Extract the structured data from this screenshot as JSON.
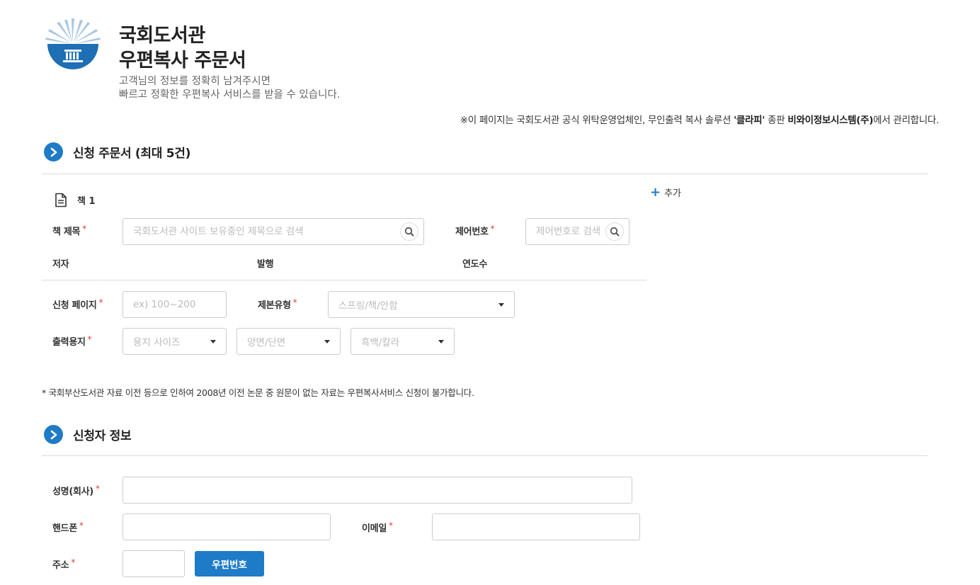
{
  "header": {
    "title_line1": "국회도서관",
    "title_line2": "우편복사 주문서",
    "subtitle_line1": "고객님의 정보를 정확히 남겨주시면",
    "subtitle_line2": "빠르고 정확한 우편복사 서비스를 받을 수 있습니다.",
    "notice_prefix": "※이 페이지는 국회도서관 공식 위탁운영업체인, 무인출력 복사 솔루션 ",
    "notice_brand": "'클라피'",
    "notice_mid": " 종판 ",
    "notice_company": "비와이정보시스템(주)",
    "notice_suffix": "에서 관리합니다."
  },
  "order_section": {
    "title": "신청 주문서 (최대 5건)",
    "add_label": "추가",
    "book_label": "책 1",
    "book_title_label": "책 제목",
    "book_title_placeholder": "국회도서관 사이트 보유중인 제목으로 검색",
    "control_no_label": "제어번호",
    "control_no_placeholder": "제어번호로 검색",
    "author_label": "저자",
    "publisher_label": "발행",
    "year_label": "연도수",
    "pages_label": "신청 페이지",
    "pages_placeholder": "ex) 100~200",
    "binding_label": "제본유형",
    "binding_value": "스프링/책/안함",
    "paper_label": "출력용지",
    "paper_size_value": "용지 사이즈",
    "duplex_value": "양면/단면",
    "color_value": "흑백/칼라",
    "footnote": "* 국회부산도서관 자료 이전 등으로 인하여 2008년 이전 논문 중 원문이 없는 자료는 우편복사서비스 신청이 불가합니다."
  },
  "applicant_section": {
    "title": "신청자 정보",
    "name_label": "성명(회사)",
    "phone_label": "핸드폰",
    "email_label": "이메일",
    "address_label": "주소",
    "zip_button": "우편번호"
  },
  "colors": {
    "accent": "#1e7bc7",
    "required": "#e23b3b"
  }
}
